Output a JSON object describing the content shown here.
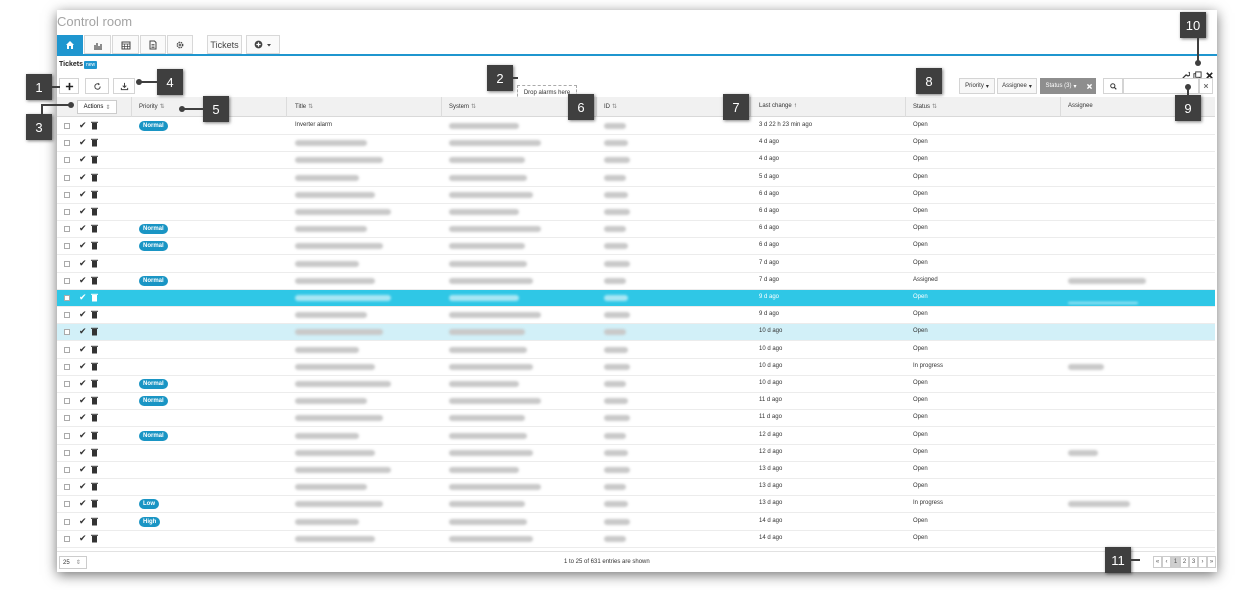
{
  "app": {
    "title": "Control room"
  },
  "nav": {
    "buttons": [
      {
        "icon": "home-icon"
      },
      {
        "icon": "chart-icon"
      },
      {
        "icon": "calendar-icon"
      },
      {
        "icon": "document-icon"
      },
      {
        "icon": "gear-icon"
      }
    ],
    "tickets_label": "Tickets",
    "add_icon": "plus-circle-icon"
  },
  "panel": {
    "title": "Tickets",
    "badge": "new"
  },
  "toolbar": {
    "drop_zone": "Drop alarms here",
    "filters": {
      "priority": "Priority",
      "assignee": "Assignee",
      "status": "Status (3)"
    },
    "search_placeholder": ""
  },
  "columns": {
    "actions": "Actions",
    "priority": "Priority",
    "title": "Title",
    "system": "System",
    "id": "ID",
    "last_change": "Last change",
    "status": "Status",
    "assignee": "Assignee"
  },
  "rows": [
    {
      "priority": "Normal",
      "title": "Inverter alarm",
      "last_change": "3 d 22 h 23 min ago",
      "status": "Open",
      "assignee": ""
    },
    {
      "priority": "",
      "title": "",
      "last_change": "4 d ago",
      "status": "Open",
      "assignee": ""
    },
    {
      "priority": "",
      "title": "",
      "last_change": "4 d ago",
      "status": "Open",
      "assignee": ""
    },
    {
      "priority": "",
      "title": "",
      "last_change": "5 d ago",
      "status": "Open",
      "assignee": ""
    },
    {
      "priority": "",
      "title": "",
      "last_change": "6 d ago",
      "status": "Open",
      "assignee": ""
    },
    {
      "priority": "",
      "title": "",
      "last_change": "6 d ago",
      "status": "Open",
      "assignee": ""
    },
    {
      "priority": "Normal",
      "title": "",
      "last_change": "6 d ago",
      "status": "Open",
      "assignee": ""
    },
    {
      "priority": "Normal",
      "title": "",
      "last_change": "6 d ago",
      "status": "Open",
      "assignee": ""
    },
    {
      "priority": "",
      "title": "",
      "last_change": "7 d ago",
      "status": "Open",
      "assignee": ""
    },
    {
      "priority": "Normal",
      "title": "",
      "last_change": "7 d ago",
      "status": "Assigned",
      "assignee": ""
    },
    {
      "priority": "",
      "title": "",
      "last_change": "9 d ago",
      "status": "Open",
      "assignee": ""
    },
    {
      "priority": "",
      "title": "",
      "last_change": "9 d ago",
      "status": "Open",
      "assignee": ""
    },
    {
      "priority": "",
      "title": "",
      "last_change": "10 d ago",
      "status": "Open",
      "assignee": ""
    },
    {
      "priority": "",
      "title": "",
      "last_change": "10 d ago",
      "status": "Open",
      "assignee": ""
    },
    {
      "priority": "",
      "title": "",
      "last_change": "10 d ago",
      "status": "In progress",
      "assignee": ""
    },
    {
      "priority": "Normal",
      "title": "",
      "last_change": "10 d ago",
      "status": "Open",
      "assignee": ""
    },
    {
      "priority": "Normal",
      "title": "",
      "last_change": "11 d ago",
      "status": "Open",
      "assignee": ""
    },
    {
      "priority": "",
      "title": "",
      "last_change": "11 d ago",
      "status": "Open",
      "assignee": ""
    },
    {
      "priority": "Normal",
      "title": "",
      "last_change": "12 d ago",
      "status": "Open",
      "assignee": ""
    },
    {
      "priority": "",
      "title": "",
      "last_change": "12 d ago",
      "status": "Open",
      "assignee": ""
    },
    {
      "priority": "",
      "title": "",
      "last_change": "13 d ago",
      "status": "Open",
      "assignee": ""
    },
    {
      "priority": "",
      "title": "",
      "last_change": "13 d ago",
      "status": "Open",
      "assignee": ""
    },
    {
      "priority": "Low",
      "title": "",
      "last_change": "13 d ago",
      "status": "In progress",
      "assignee": ""
    },
    {
      "priority": "High",
      "title": "",
      "last_change": "14 d ago",
      "status": "Open",
      "assignee": ""
    },
    {
      "priority": "",
      "title": "",
      "last_change": "14 d ago",
      "status": "Open",
      "assignee": ""
    }
  ],
  "footer": {
    "page_size": "25",
    "entries_text": "1 to 25 of 631 entries are shown",
    "pages": [
      "1",
      "2",
      "3"
    ],
    "current_page": "1"
  },
  "callouts": [
    "1",
    "2",
    "3",
    "4",
    "5",
    "6",
    "7",
    "8",
    "9",
    "10",
    "11"
  ],
  "colors": {
    "accent": "#1f96cf",
    "selected_row": "#2fc7e6",
    "hover_row": "#d2f0f8",
    "priority_pill": "#1a95c4",
    "callout": "#3f3f3f"
  }
}
